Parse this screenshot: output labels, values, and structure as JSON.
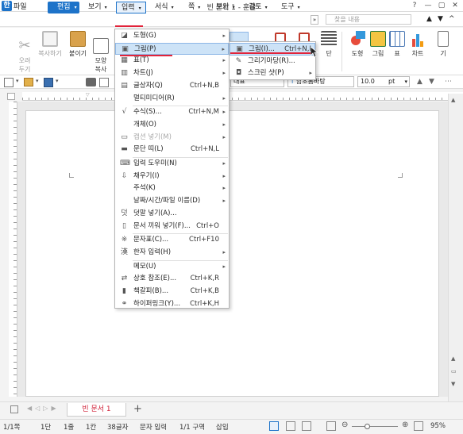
{
  "window": {
    "app_icon": "한",
    "title": "빈 문서 1 - 훈글",
    "controls": [
      "?",
      "—",
      "▢",
      "✕"
    ]
  },
  "menubar": {
    "items": [
      "파일",
      "편집",
      "보기",
      "입력",
      "서식",
      "쪽",
      "보안",
      "검토",
      "도구"
    ],
    "more": "»",
    "search_placeholder": "찾을 내용",
    "collapse": "^"
  },
  "ribbon": {
    "left_buttons": [
      {
        "label": "오려\n두기",
        "icon": "scissors-icon"
      },
      {
        "label": "복사하기",
        "icon": "copy-icon"
      },
      {
        "label": "붙이기",
        "icon": "paste-icon"
      },
      {
        "label": "모양\n복사",
        "icon": "format-painter-icon"
      }
    ],
    "right_buttons": [
      {
        "label": "단",
        "icon": "columns-icon"
      },
      {
        "label": "도형",
        "icon": "shapes-icon"
      },
      {
        "label": "그림",
        "icon": "picture-icon"
      },
      {
        "label": "표",
        "icon": "table-icon"
      },
      {
        "label": "차트",
        "icon": "chart-icon"
      },
      {
        "label": "기",
        "icon": "more-icon"
      }
    ]
  },
  "format_toolbar": {
    "language": "대표",
    "font": "함초롬바탕",
    "size": "10.0",
    "unit": "pt"
  },
  "insert_menu": {
    "items": [
      {
        "label": "도형(G)",
        "shortcut": "",
        "submenu": true,
        "icon": "shape-icon"
      },
      {
        "label": "그림(P)",
        "shortcut": "",
        "submenu": true,
        "icon": "picture-icon",
        "highlighted": true
      },
      {
        "label": "표(T)",
        "shortcut": "",
        "submenu": true,
        "icon": "table-icon"
      },
      {
        "label": "차트(J)",
        "shortcut": "",
        "submenu": true,
        "icon": "chart-icon"
      },
      {
        "label": "글상자(Q)",
        "shortcut": "Ctrl+N,B",
        "submenu": false,
        "icon": "textbox-icon"
      },
      {
        "label": "멀티미디어(R)",
        "shortcut": "",
        "submenu": true,
        "icon": ""
      },
      {
        "label": "수식(S)...",
        "shortcut": "Ctrl+N,M",
        "submenu": true,
        "icon": "formula-icon",
        "sep_before": true
      },
      {
        "label": "개체(O)",
        "shortcut": "",
        "submenu": true,
        "icon": ""
      },
      {
        "label": "캡션 넣기(M)",
        "shortcut": "",
        "submenu": true,
        "icon": "caption-icon",
        "disabled": true
      },
      {
        "label": "문단 띠(L)",
        "shortcut": "Ctrl+N,L",
        "submenu": false,
        "icon": "paragraph-band-icon"
      },
      {
        "label": "입력 도우미(N)",
        "shortcut": "",
        "submenu": true,
        "icon": "input-helper-icon",
        "sep_before": true
      },
      {
        "label": "채우기(I)",
        "shortcut": "",
        "submenu": true,
        "icon": "fill-icon"
      },
      {
        "label": "주석(K)",
        "shortcut": "",
        "submenu": true,
        "icon": ""
      },
      {
        "label": "날짜/시간/파일 이름(D)",
        "shortcut": "",
        "submenu": true,
        "icon": ""
      },
      {
        "label": "덧말 넣기(A)...",
        "shortcut": "",
        "submenu": false,
        "icon": "ruby-icon"
      },
      {
        "label": "문서 끼워 넣기(F)...",
        "shortcut": "Ctrl+O",
        "submenu": false,
        "icon": "insert-doc-icon"
      },
      {
        "label": "문자표(C)...",
        "shortcut": "Ctrl+F10",
        "submenu": false,
        "icon": "symbol-icon",
        "sep_before": true
      },
      {
        "label": "한자 입력(H)",
        "shortcut": "",
        "submenu": true,
        "icon": "hanja-icon"
      },
      {
        "label": "메모(U)",
        "shortcut": "",
        "submenu": true,
        "icon": "",
        "sep_before": true
      },
      {
        "label": "상호 참조(E)...",
        "shortcut": "Ctrl+K,R",
        "submenu": false,
        "icon": "cross-ref-icon"
      },
      {
        "label": "책갈피(B)...",
        "shortcut": "Ctrl+K,B",
        "submenu": false,
        "icon": "bookmark-icon"
      },
      {
        "label": "하이퍼링크(Y)...",
        "shortcut": "Ctrl+K,H",
        "submenu": false,
        "icon": "hyperlink-icon"
      }
    ]
  },
  "picture_submenu": {
    "items": [
      {
        "label": "그림(I)...",
        "shortcut": "Ctrl+N,I",
        "icon": "image-icon",
        "highlighted": true
      },
      {
        "label": "그리기마당(R)...",
        "shortcut": "",
        "icon": "clipart-icon"
      },
      {
        "label": "스크린 샷(P)",
        "shortcut": "",
        "icon": "screenshot-icon",
        "submenu": true
      }
    ]
  },
  "document": {
    "tab_label": "빈 문서 1",
    "add_tab": "+"
  },
  "statusbar": {
    "page": "1/1쪽",
    "column": "1단",
    "line": "1줄",
    "col_pos": "1칸",
    "chars": "38글자",
    "mode": "문자 입력",
    "section": "1/1 구역",
    "insert": "삽입",
    "zoom": "95%",
    "zoom_fraction": 0.95
  },
  "colors": {
    "accent": "#1d73c9",
    "highlight": "#cde3f7",
    "underline_red": "#e2233a"
  }
}
